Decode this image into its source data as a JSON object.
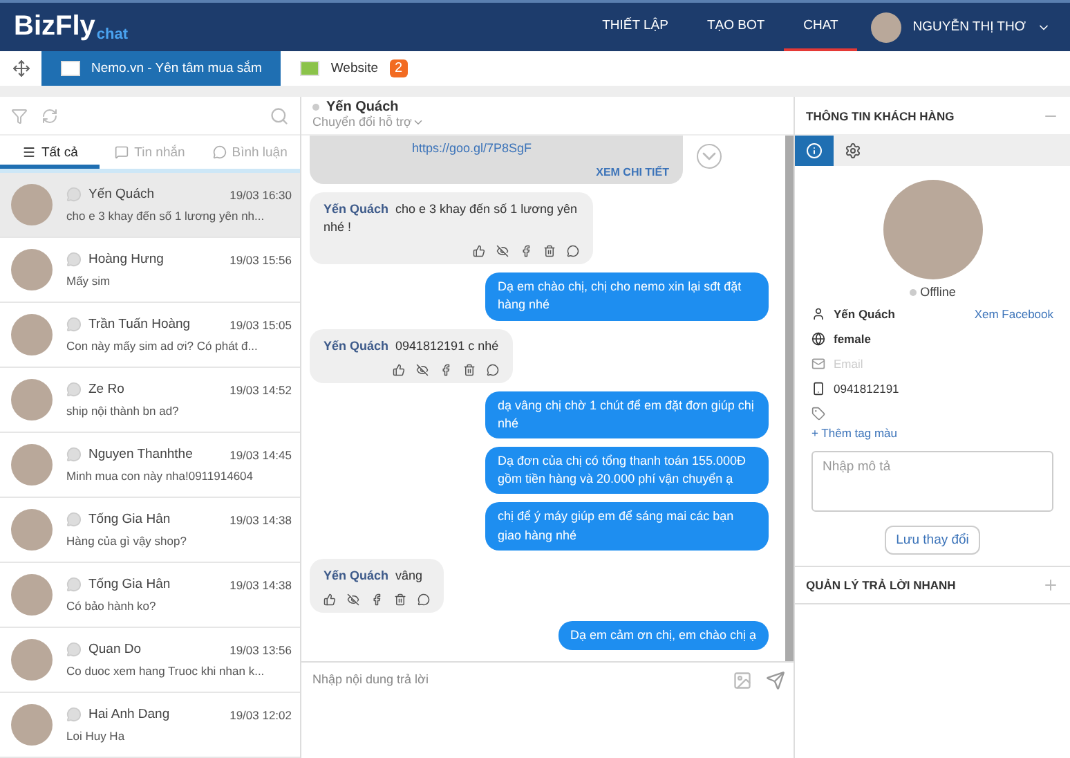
{
  "brand": {
    "logo": "BizFly",
    "sub": "chat"
  },
  "nav": [
    {
      "label": "THIẾT LẬP",
      "selected": false
    },
    {
      "label": "TẠO BOT",
      "selected": false
    },
    {
      "label": "CHAT",
      "selected": true
    }
  ],
  "user": {
    "name": "NGUYỄN THỊ THƠ"
  },
  "pages": [
    {
      "label": "Nemo.vn - Yên tâm mua sắm",
      "selected": true
    },
    {
      "label": "Website",
      "selected": false,
      "badge": "2"
    }
  ],
  "filters": [
    {
      "label": "Tất cả",
      "selected": true
    },
    {
      "label": "Tin nhắn",
      "selected": false
    },
    {
      "label": "Bình luận",
      "selected": false
    }
  ],
  "conversations": [
    {
      "name": "Yến Quách",
      "time": "19/03 16:30",
      "preview": "cho e 3 khay đến số 1 lương yên nh...",
      "selected": true
    },
    {
      "name": "Hoàng Hưng",
      "time": "19/03 15:56",
      "preview": "Mấy sim",
      "selected": false
    },
    {
      "name": "Trần Tuấn Hoàng",
      "time": "19/03 15:05",
      "preview": "Con này mấy sim ad ơi? Có phát đ...",
      "selected": false
    },
    {
      "name": "Ze Ro",
      "time": "19/03 14:52",
      "preview": "ship nội thành bn ad?",
      "selected": false
    },
    {
      "name": "Nguyen Thanhthe",
      "time": "19/03 14:45",
      "preview": "Minh mua con này nha!0911914604",
      "selected": false
    },
    {
      "name": "Tống Gia Hân",
      "time": "19/03 14:38",
      "preview": "Hàng của gì vậy shop?",
      "selected": false
    },
    {
      "name": "Tống Gia Hân",
      "time": "19/03 14:38",
      "preview": "Có bảo hành ko?",
      "selected": false
    },
    {
      "name": "Quan Do",
      "time": "19/03 13:56",
      "preview": "Co duoc xem hang Truoc khi nhan k...",
      "selected": false
    },
    {
      "name": "Hai Anh Dang",
      "time": "19/03 12:02",
      "preview": "Loi Huy Ha",
      "selected": false
    }
  ],
  "chat": {
    "name": "Yến Quách",
    "mode": "Chuyển đổi hỗ trợ",
    "messages": [
      {
        "kind": "card",
        "link": "https://goo.gl/7P8SgF",
        "action": "XEM CHI TIẾT"
      },
      {
        "kind": "incoming",
        "sender": "Yến Quách",
        "text": "cho e 3 khay đến số 1 lương yên nhé !"
      },
      {
        "kind": "outgoing",
        "text": "Dạ em chào chị, chị cho nemo xin lại sđt đặt hàng nhé"
      },
      {
        "kind": "incoming",
        "sender": "Yến Quách",
        "text": "0941812191 c nhé"
      },
      {
        "kind": "outgoing",
        "text": "dạ vâng chị chờ 1 chút để em đặt đơn giúp chị nhé"
      },
      {
        "kind": "outgoing",
        "text": "Dạ đơn của chị có tổng thanh toán 155.000Đ gồm tiền hàng và 20.000 phí vận chuyển ạ"
      },
      {
        "kind": "outgoing",
        "text": "chị để ý máy giúp em để sáng mai các bạn giao hàng nhé"
      },
      {
        "kind": "incoming",
        "sender": "Yến Quách",
        "text": "vâng"
      },
      {
        "kind": "outgoing",
        "text": "Dạ em cảm ơn chị, em chào chị ạ"
      }
    ],
    "composer": {
      "placeholder": "Nhập nội dung trả lời"
    }
  },
  "customer": {
    "title": "THÔNG TIN KHÁCH HÀNG",
    "status": "Offline",
    "name": "Yến Quách",
    "facebook": "Xem Facebook",
    "gender": "female",
    "email_placeholder": "Email",
    "phone": "0941812191",
    "add_tag": "+ Thêm tag màu",
    "note_placeholder": "Nhập mô tả",
    "save": "Lưu thay đổi"
  },
  "quick_replies": {
    "title": "QUẢN LÝ TRẢ LỜI NHANH"
  }
}
